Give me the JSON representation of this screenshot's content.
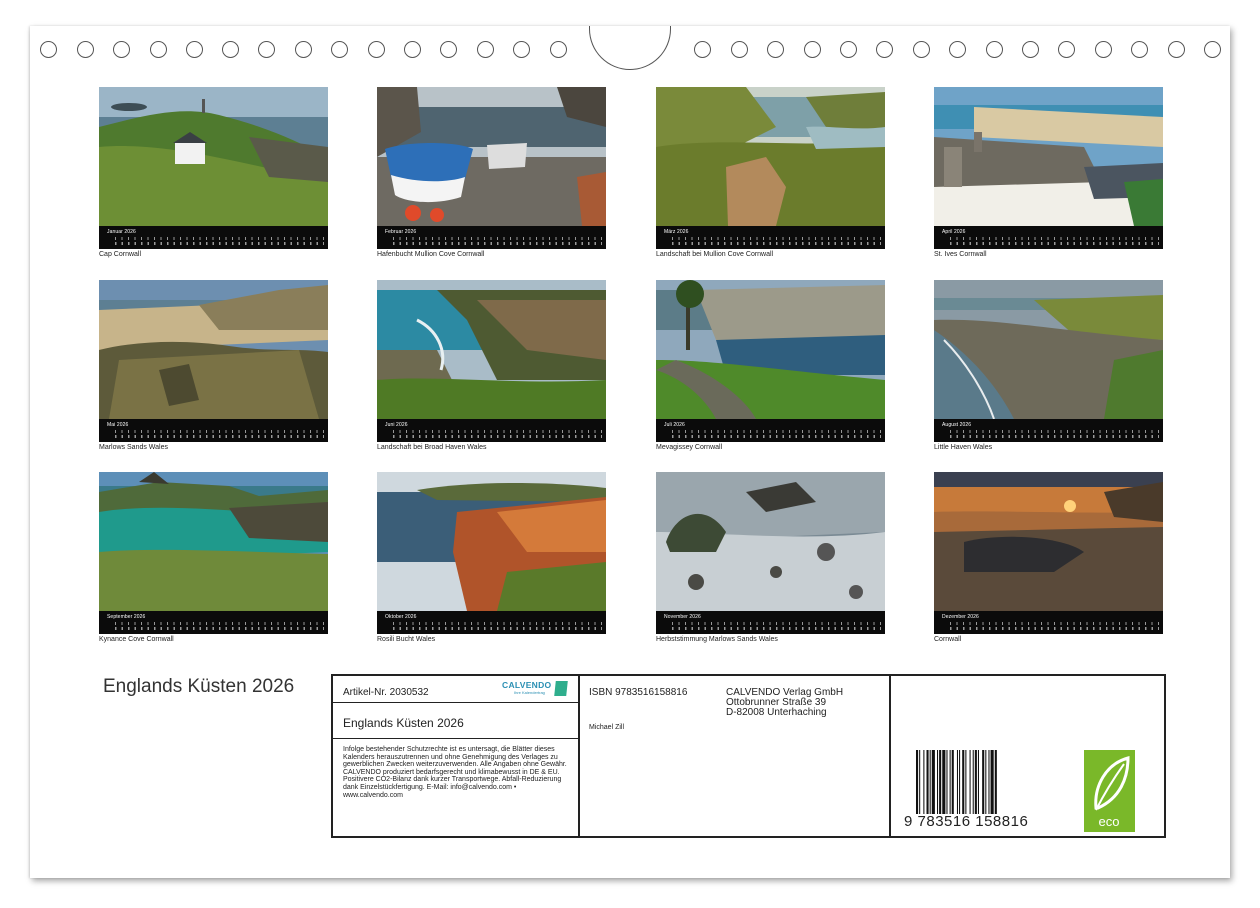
{
  "calendar": {
    "title": "Englands Küsten 2026",
    "months": [
      {
        "name": "Januar 2026",
        "caption": "Cap Cornwall",
        "scene": "headland"
      },
      {
        "name": "Februar 2026",
        "caption": "Hafenbucht Mullion Cove   Cornwall",
        "scene": "harbour"
      },
      {
        "name": "März 2026",
        "caption": "Landschaft bei Mullion Cove   Cornwall",
        "scene": "cove"
      },
      {
        "name": "April 2026",
        "caption": "St. Ives   Cornwall",
        "scene": "town"
      },
      {
        "name": "Mai 2026",
        "caption": "Marlows Sands   Wales",
        "scene": "rocks"
      },
      {
        "name": "Juni 2026",
        "caption": "Landschaft bei Broad Haven   Wales",
        "scene": "cliffs"
      },
      {
        "name": "Juli 2026",
        "caption": "Mevagissey   Cornwall",
        "scene": "village"
      },
      {
        "name": "August 2026",
        "caption": "Little Haven   Wales",
        "scene": "beach"
      },
      {
        "name": "September 2026",
        "caption": "Kynance Cove   Cornwall",
        "scene": "lagoon"
      },
      {
        "name": "Oktober 2026",
        "caption": "Rosili Bucht   Wales",
        "scene": "redcliff"
      },
      {
        "name": "November 2026",
        "caption": "Herbststimmung Marlows Sands   Wales",
        "scene": "longexposure"
      },
      {
        "name": "Dezember 2026",
        "caption": "Cornwall",
        "scene": "sunset"
      }
    ]
  },
  "info": {
    "article": "Artikel-Nr. 2030532",
    "logo": "CALVENDO",
    "logo_sub": "Ihre Kalendertrag",
    "product_title": "Englands Küsten 2026",
    "legal": "Infolge bestehender Schutzrechte ist es untersagt, die Blätter dieses Kalenders herauszutrennen und ohne Genehmigung des Verlages zu gewerblichen Zwecken weiterzuverwenden. Alle Angaben ohne Gewähr. CALVENDO produziert bedarfsgerecht und klimabewusst in DE & EU. Positivere CO2-Bilanz dank kurzer Transportwege. Abfall-Reduzierung dank Einzelstückfertigung. E-Mail: info@calvendo.com • www.calvendo.com",
    "isbn": "ISBN 9783516158816",
    "author": "Michael Zill",
    "publisher_name": "CALVENDO Verlag GmbH",
    "publisher_street": "Ottobrunner Straße 39",
    "publisher_city": "D-82008 Unterhaching",
    "barcode_digits": "9   783516   158816",
    "eco_label": "eco",
    "eco_color": "#7ab829"
  }
}
